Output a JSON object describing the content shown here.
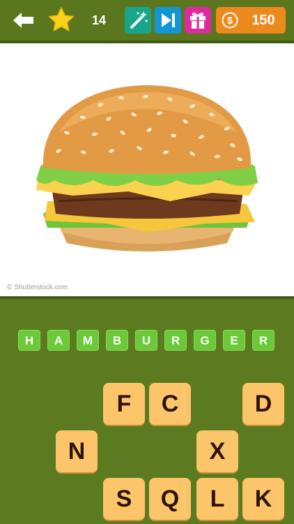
{
  "header": {
    "level": "14",
    "coins": "150",
    "back_icon": "back-arrow-icon",
    "level_icon": "star-icon",
    "powerups": [
      "magic-wand-icon",
      "skip-icon",
      "gift-icon"
    ],
    "coin_icon": "dollar-coin-icon"
  },
  "puzzle": {
    "image": "hamburger",
    "credit": "© Shutterstock.com"
  },
  "answer": [
    "H",
    "A",
    "M",
    "B",
    "U",
    "R",
    "G",
    "E",
    "R"
  ],
  "letters": {
    "row1": [
      "F",
      "C",
      "D"
    ],
    "row2": [
      "N",
      "X"
    ],
    "row3": [
      "S",
      "Q",
      "L",
      "K"
    ]
  },
  "colors": {
    "background": "#5c7a1f",
    "answer_tile": "#6cc93a",
    "letter_tile": "#fcc56a",
    "coin_button": "#ec8a1d",
    "magic_button": "#16a68b",
    "skip_button": "#1296d6",
    "gift_button": "#dc2a9f"
  }
}
